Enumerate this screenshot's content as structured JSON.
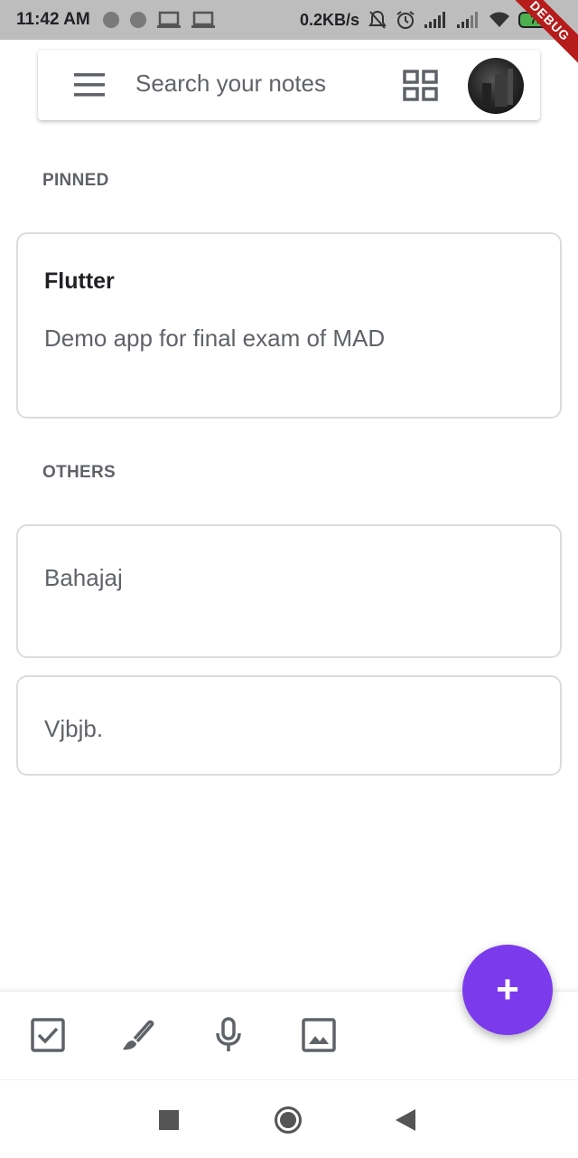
{
  "status_bar": {
    "time": "11:42 AM",
    "net_speed": "0.2KB/s",
    "battery": "71",
    "icons": [
      "circle-icon",
      "circle-icon",
      "laptop-icon",
      "laptop-icon",
      "mute-icon",
      "alarm-icon",
      "signal-icon",
      "signal-icon",
      "wifi-icon",
      "battery-icon"
    ]
  },
  "debug_banner": "DEBUG",
  "search_bar": {
    "placeholder": "Search your notes",
    "menu_icon": "menu-icon",
    "view_toggle_icon": "grid-view-icon",
    "avatar_icon": "profile-avatar"
  },
  "sections": {
    "pinned_label": "PINNED",
    "others_label": "OTHERS"
  },
  "pinned_notes": [
    {
      "title": "Flutter",
      "body": "Demo app for final exam of MAD"
    }
  ],
  "other_notes": [
    {
      "title": "",
      "body": "Bahajaj"
    },
    {
      "title": "",
      "body": "Vjbjb."
    }
  ],
  "fab": {
    "label": "+",
    "icon": "add-icon"
  },
  "bottom_toolbar": {
    "icons": [
      "checkbox-icon",
      "brush-icon",
      "mic-icon",
      "image-icon"
    ]
  },
  "nav_bar": {
    "icons": [
      "recents-icon",
      "home-icon",
      "back-icon"
    ]
  },
  "colors": {
    "accent": "#7c3aed",
    "status_bar_bg": "#bdbdbd",
    "card_border": "#dadce0",
    "secondary_text": "#5f6368"
  }
}
